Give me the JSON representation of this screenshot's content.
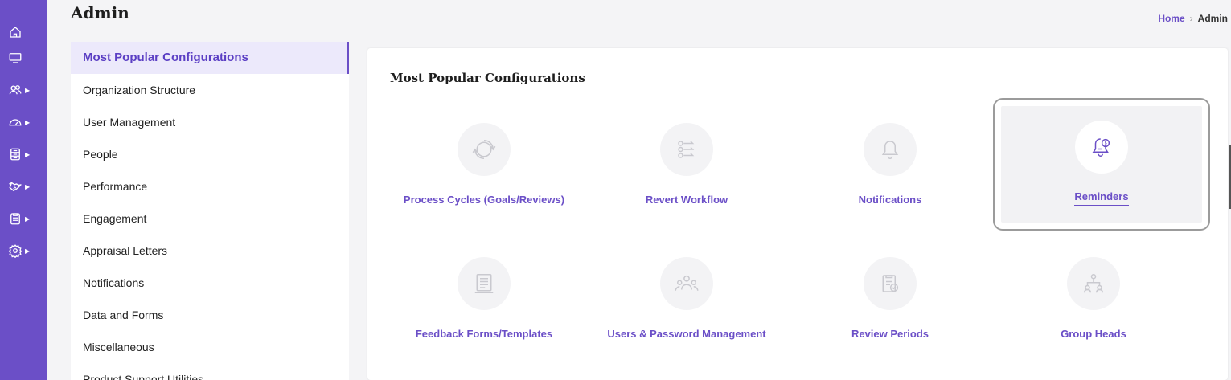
{
  "rail": {
    "items": [
      {
        "icon": "home-icon"
      },
      {
        "icon": "monitor-icon"
      },
      {
        "icon": "users-icon",
        "expandable": true
      },
      {
        "icon": "speedometer-icon",
        "expandable": true
      },
      {
        "icon": "database-icon",
        "expandable": true
      },
      {
        "icon": "handshake-icon",
        "expandable": true
      },
      {
        "icon": "clipboard-icon",
        "expandable": true
      },
      {
        "icon": "settings-icon",
        "expandable": true
      }
    ],
    "color": "#6b4fc7"
  },
  "header": {
    "title": "Admin",
    "breadcrumb": {
      "home": "Home",
      "separator": "›",
      "current": "Admin"
    }
  },
  "menu": {
    "items": [
      {
        "label": "Most Popular Configurations",
        "active": true
      },
      {
        "label": "Organization Structure"
      },
      {
        "label": "User Management"
      },
      {
        "label": "People"
      },
      {
        "label": "Performance"
      },
      {
        "label": "Engagement"
      },
      {
        "label": "Appraisal Letters"
      },
      {
        "label": "Notifications"
      },
      {
        "label": "Data and Forms"
      },
      {
        "label": "Miscellaneous"
      },
      {
        "label": "Product Support Utilities"
      }
    ]
  },
  "main": {
    "title": "Most Popular Configurations",
    "tiles": [
      {
        "label": "Process Cycles (Goals/Reviews)",
        "icon": "cycle-icon"
      },
      {
        "label": "Revert Workflow",
        "icon": "workflow-icon"
      },
      {
        "label": "Notifications",
        "icon": "bell-icon"
      },
      {
        "label": "Reminders",
        "icon": "bell-clock-icon",
        "selected": true
      },
      {
        "label": "Feedback Forms/Templates",
        "icon": "form-template-icon"
      },
      {
        "label": "Users & Password Management",
        "icon": "users-group-icon"
      },
      {
        "label": "Review Periods",
        "icon": "clipboard-check-icon"
      },
      {
        "label": "Group Heads",
        "icon": "hierarchy-icon"
      }
    ]
  },
  "colors": {
    "accent": "#6b4fc7",
    "accent_light": "#ece9fb"
  }
}
